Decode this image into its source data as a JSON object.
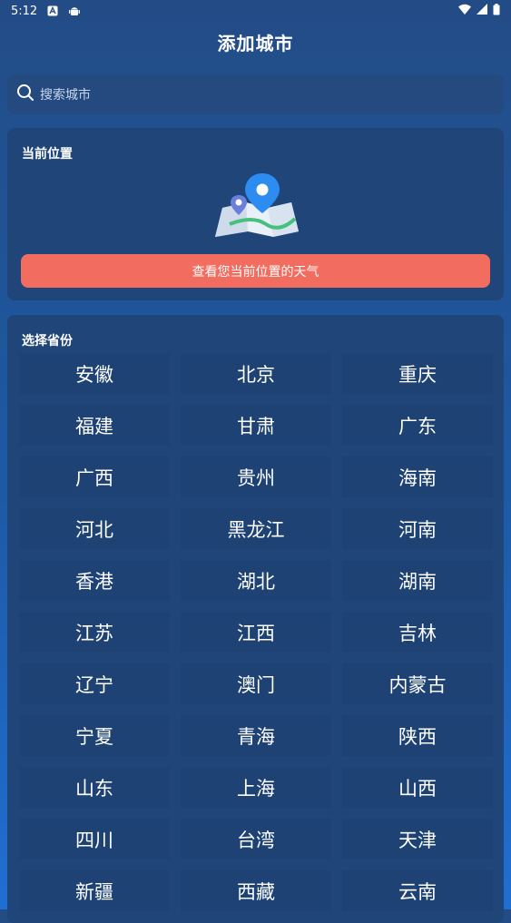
{
  "status_bar": {
    "time": "5:12",
    "icons": [
      "notification-a-icon",
      "android-icon",
      "wifi-icon",
      "signal-icon",
      "battery-icon"
    ]
  },
  "header": {
    "title": "添加城市"
  },
  "search": {
    "placeholder": "搜索城市"
  },
  "location": {
    "section_title": "当前位置",
    "button_label": "查看您当前位置的天气"
  },
  "provinces": {
    "section_title": "选择省份",
    "items": [
      "安徽",
      "北京",
      "重庆",
      "福建",
      "甘肃",
      "广东",
      "广西",
      "贵州",
      "海南",
      "河北",
      "黑龙江",
      "河南",
      "香港",
      "湖北",
      "湖南",
      "江苏",
      "江西",
      "吉林",
      "辽宁",
      "澳门",
      "内蒙古",
      "宁夏",
      "青海",
      "陕西",
      "山东",
      "上海",
      "山西",
      "四川",
      "台湾",
      "天津",
      "新疆",
      "西藏",
      "云南"
    ]
  },
  "colors": {
    "accent_button": "#f26d5f",
    "card_bg": "#1f4579",
    "cell_bg": "#1d4273"
  }
}
